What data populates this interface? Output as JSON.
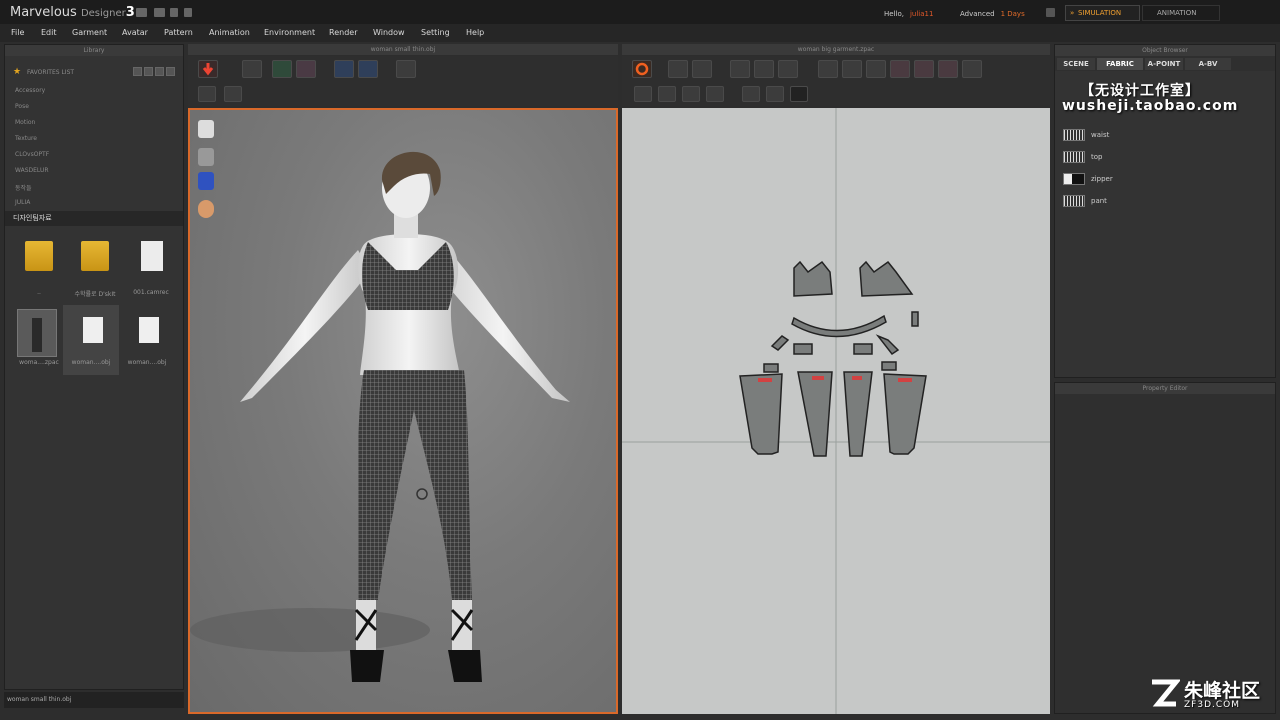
{
  "app": {
    "name": "Marvelous",
    "designer": "Designer",
    "version": "3"
  },
  "account": {
    "hello": "Hello,",
    "user": "julia11",
    "license": "Advanced",
    "days": "1 Days"
  },
  "modes": {
    "simulation": "SIMULATION",
    "animation": "ANIMATION"
  },
  "menu": [
    "File",
    "Edit",
    "Garment",
    "Avatar",
    "Pattern",
    "Animation",
    "Environment",
    "Render",
    "Window",
    "Setting",
    "Help"
  ],
  "library": {
    "title": "Library",
    "favorites_label": "FAVORITES LIST",
    "items": [
      "Accessory",
      "Pose",
      "Motion",
      "Texture",
      "CLOvsOPTF",
      "WASDELUR",
      "동작들",
      "JULIA"
    ],
    "selected_folder": "디자인팀자료",
    "thumbnails": [
      {
        "type": "folder",
        "caption": ".."
      },
      {
        "type": "folder",
        "caption": "수학률로 D'skIt"
      },
      {
        "type": "file",
        "caption": "001.camrec"
      },
      {
        "type": "avatar",
        "caption": "woma....zpac"
      },
      {
        "type": "obj",
        "caption": "woman....obj"
      },
      {
        "type": "obj",
        "caption": "woman....obj"
      }
    ],
    "status": "woman small thin.obj"
  },
  "viewport3d": {
    "title": "woman small thin.obj"
  },
  "viewport2d": {
    "title": "woman big garment.zpac"
  },
  "object_browser": {
    "title": "Object Browser",
    "tabs": [
      "SCENE",
      "FABRIC",
      "A-POINT",
      "A-BV"
    ],
    "active_tab": "FABRIC",
    "fabrics": [
      {
        "name": "waist",
        "swatch": "check"
      },
      {
        "name": "top",
        "swatch": "check"
      },
      {
        "name": "zipper",
        "swatch": "dark"
      },
      {
        "name": "pant",
        "swatch": "check"
      }
    ]
  },
  "property_editor": {
    "title": "Property Editor"
  },
  "watermark": {
    "line1": "【无设计工作室】",
    "line2": "wusheji.taobao.com",
    "site_main": "朱峰社区",
    "site_sub": "ZF3D.COM"
  },
  "colors": {
    "accent_orange": "#d9692a",
    "title_orange": "#e06b2a",
    "star": "#e3a520"
  }
}
